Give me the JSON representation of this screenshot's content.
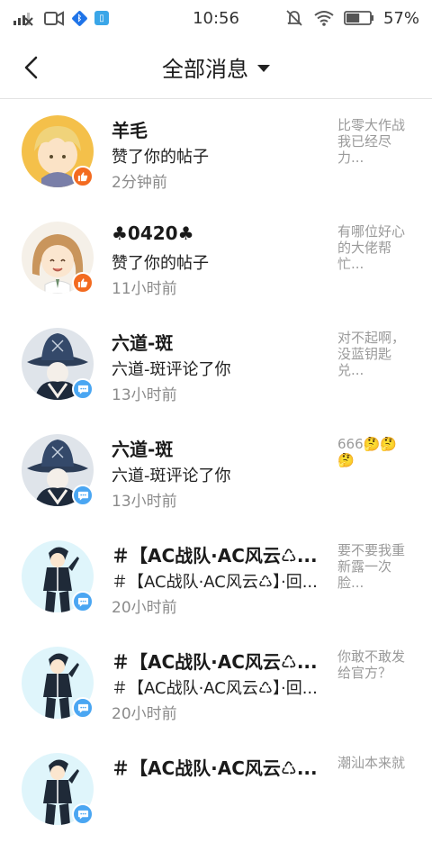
{
  "status_bar": {
    "time": "10:56",
    "battery": "57%",
    "battery_level": 0.57
  },
  "header": {
    "title": "全部消息"
  },
  "messages": [
    {
      "name": "羊毛",
      "action": "赞了你的帖子",
      "time": "2分钟前",
      "preview": "比零大作战我已经尽力...",
      "badge": "like",
      "avatar": "blonde"
    },
    {
      "name": "♣0420♣",
      "action": "赞了你的帖子",
      "time": "11小时前",
      "preview": "有哪位好心的大佬帮忙...",
      "badge": "like",
      "avatar": "brown"
    },
    {
      "name": "六道-斑",
      "action": "六道-斑评论了你",
      "time": "13小时前",
      "preview": "对不起啊，没蓝钥匙兑...",
      "badge": "comment",
      "avatar": "hat"
    },
    {
      "name": "六道-斑",
      "action": "六道-斑评论了你",
      "time": "13小时前",
      "preview": "666🤔🤔🤔",
      "badge": "comment",
      "avatar": "hat"
    },
    {
      "name": "＃【AC战队·AC风云♺...",
      "action": "＃【AC战队·AC风云♺】·回...",
      "time": "20小时前",
      "preview": "要不要我重新露一次脸...",
      "badge": "comment",
      "avatar": "boy"
    },
    {
      "name": "＃【AC战队·AC风云♺...",
      "action": "＃【AC战队·AC风云♺】·回...",
      "time": "20小时前",
      "preview": "你敢不敢发给官方？",
      "badge": "comment",
      "avatar": "boy"
    },
    {
      "name": "＃【AC战队·AC风云♺...",
      "action": "",
      "time": "",
      "preview": "潮汕本来就",
      "badge": "comment",
      "avatar": "boy"
    }
  ]
}
